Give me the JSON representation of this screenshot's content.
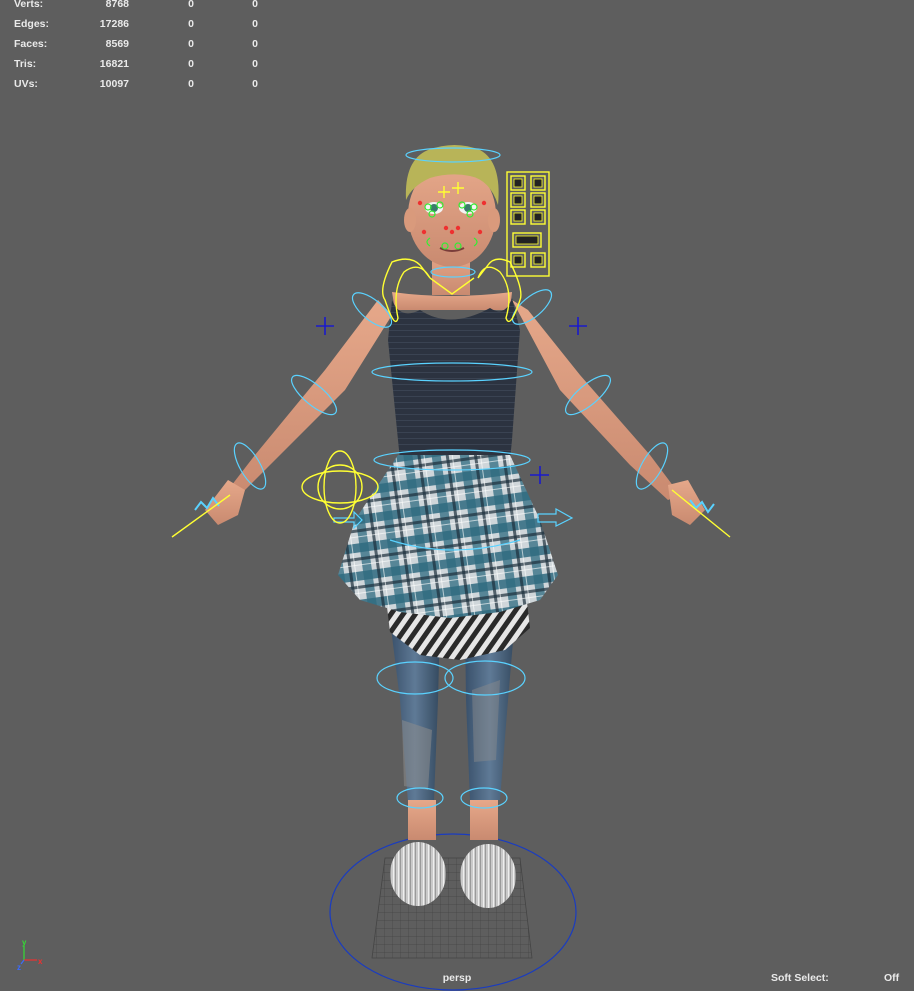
{
  "stats": {
    "rows": [
      {
        "label": "Verts:",
        "values": [
          "8768",
          "0",
          "0"
        ]
      },
      {
        "label": "Edges:",
        "values": [
          "17286",
          "0",
          "0"
        ]
      },
      {
        "label": "Faces:",
        "values": [
          "8569",
          "0",
          "0"
        ]
      },
      {
        "label": "Tris:",
        "values": [
          "16821",
          "0",
          "0"
        ]
      },
      {
        "label": "UVs:",
        "values": [
          "10097",
          "0",
          "0"
        ]
      }
    ]
  },
  "camera": {
    "name": "persp"
  },
  "soft_select": {
    "label": "Soft Select:",
    "value": "Off"
  },
  "axis": {
    "x": "x",
    "y": "y",
    "z": "z"
  },
  "colors": {
    "viewport_bg": "#5e5e5e",
    "control_cyan": "#5ad2ff",
    "control_yellow": "#ffff33",
    "control_blue": "#1a1acc",
    "control_green": "#33ee33",
    "control_red": "#ee3030"
  }
}
